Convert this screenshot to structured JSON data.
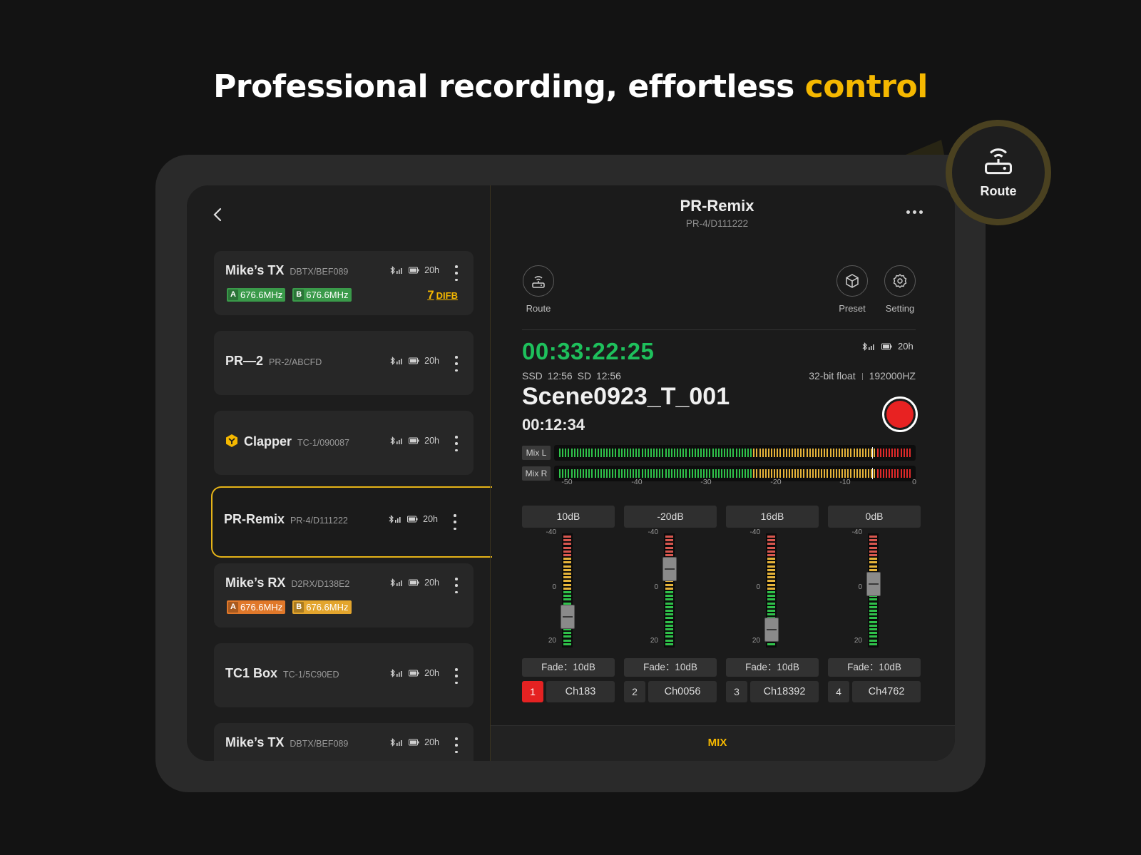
{
  "headline": {
    "text": "Professional recording, effortless ",
    "accent": "control"
  },
  "devices": [
    {
      "name": "Mike’s TX",
      "id": "DBTX/BEF089",
      "battery": "20h",
      "freq_a": "676.6MHz",
      "freq_b": "676.6MHz",
      "difb_num": "7",
      "difb_label": "DIFB"
    },
    {
      "name": "PR—2",
      "id": "PR-2/ABCFD",
      "battery": "20h"
    },
    {
      "name": "Clapper",
      "id": "TC-1/090087",
      "battery": "20h"
    },
    {
      "name": "PR-Remix",
      "id": "PR-4/D111222",
      "battery": "20h"
    },
    {
      "name": "Mike’s RX",
      "id": "D2RX/D138E2",
      "battery": "20h",
      "freq_a": "676.6MHz",
      "freq_b": "676.6MHz"
    },
    {
      "name": "TC1 Box",
      "id": "TC-1/5C90ED",
      "battery": "20h"
    },
    {
      "name": "Mike’s TX",
      "id": "DBTX/BEF089",
      "battery": "20h"
    }
  ],
  "freq_letters": {
    "a": "A",
    "b": "B"
  },
  "panel": {
    "title": "PR-Remix",
    "subtitle": "PR-4/D111222",
    "tools": {
      "route": "Route",
      "preset": "Preset",
      "setting": "Setting"
    },
    "battery": "20h",
    "timecode": "00:33:22:25",
    "storage": "SSD 12:56 SD 12:56",
    "bit_depth": "32-bit float",
    "sample_rate": "192000HZ",
    "scene": "Scene0923_T_001",
    "elapsed": "00:12:34",
    "mix_labels": {
      "left": "Mix L",
      "right": "Mix R"
    },
    "mix_levels": {
      "left": 0.87,
      "right": 0.87
    },
    "meter_ticks": [
      "-50",
      "-40",
      "-30",
      "-20",
      "-10",
      "0"
    ],
    "channel_scale": [
      "-40",
      "0",
      "20"
    ],
    "channels": [
      {
        "num": "1",
        "name": "Ch183",
        "gain": "10dB",
        "fade": "Fade：10dB",
        "fader": 0.22,
        "active": true
      },
      {
        "num": "2",
        "name": "Ch0056",
        "gain": "-20dB",
        "fade": "Fade：10dB",
        "fader": 0.74,
        "active": false
      },
      {
        "num": "3",
        "name": "Ch18392",
        "gain": "16dB",
        "fade": "Fade：10dB",
        "fader": 0.08,
        "active": false
      },
      {
        "num": "4",
        "name": "Ch4762",
        "gain": "0dB",
        "fade": "Fade：10dB",
        "fader": 0.58,
        "active": false
      }
    ],
    "tab": "MIX"
  },
  "callout": {
    "label": "Route"
  },
  "colors": {
    "accent": "#f5b800",
    "timecode": "#1ec05c",
    "record": "#e82222"
  }
}
